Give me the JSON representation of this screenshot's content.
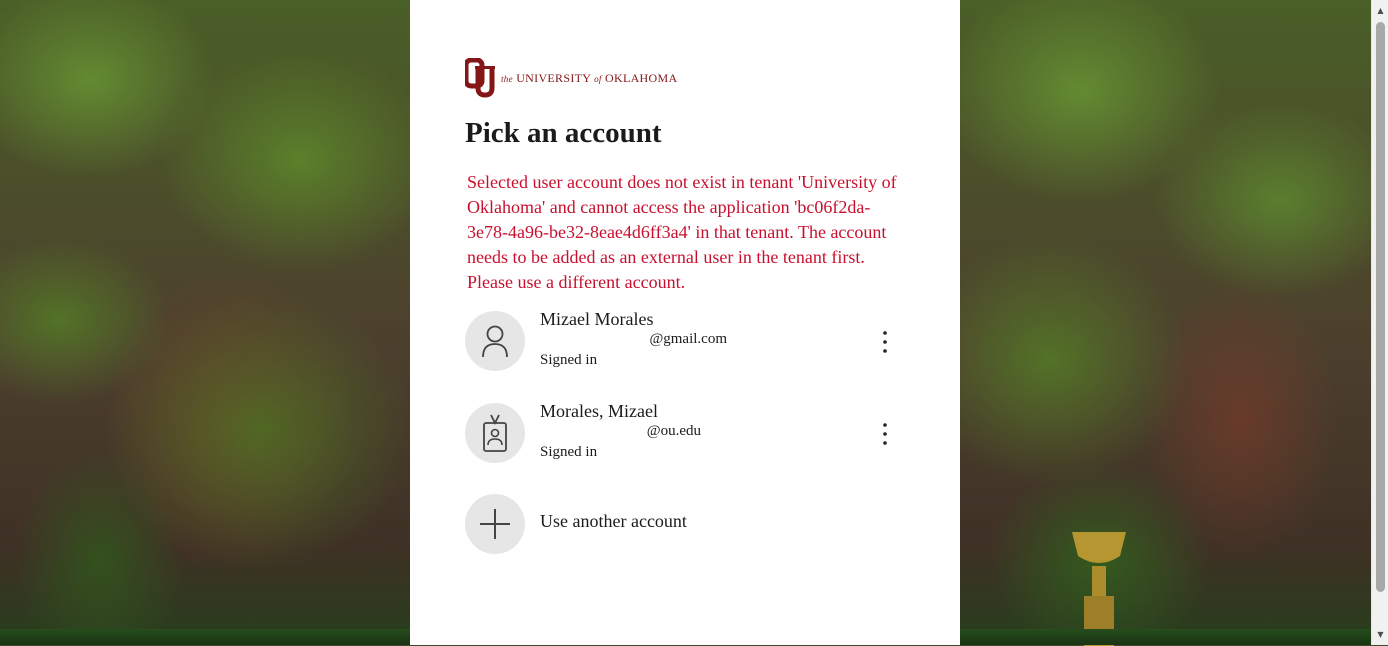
{
  "logo": {
    "prefix": "the",
    "name": "UNIVERSITY",
    "of": "of",
    "place": "OKLAHOMA",
    "brand_color": "#841617"
  },
  "page": {
    "title": "Pick an account",
    "error_message": "Selected user account does not exist in tenant 'University of Oklahoma' and cannot access the application 'bc06f2da-3e78-4a96-be32-8eae4d6ff3a4' in that tenant. The account needs to be added as an external user in the tenant first. Please use a different account.",
    "error_color": "#c8102e"
  },
  "accounts": [
    {
      "name": "Mizael Morales",
      "email": "@gmail.com",
      "status": "Signed in",
      "icon": "person-icon"
    },
    {
      "name": "Morales, Mizael",
      "email": "@ou.edu",
      "status": "Signed in",
      "icon": "badge-icon"
    }
  ],
  "another": {
    "label": "Use another account",
    "icon": "plus-icon"
  }
}
